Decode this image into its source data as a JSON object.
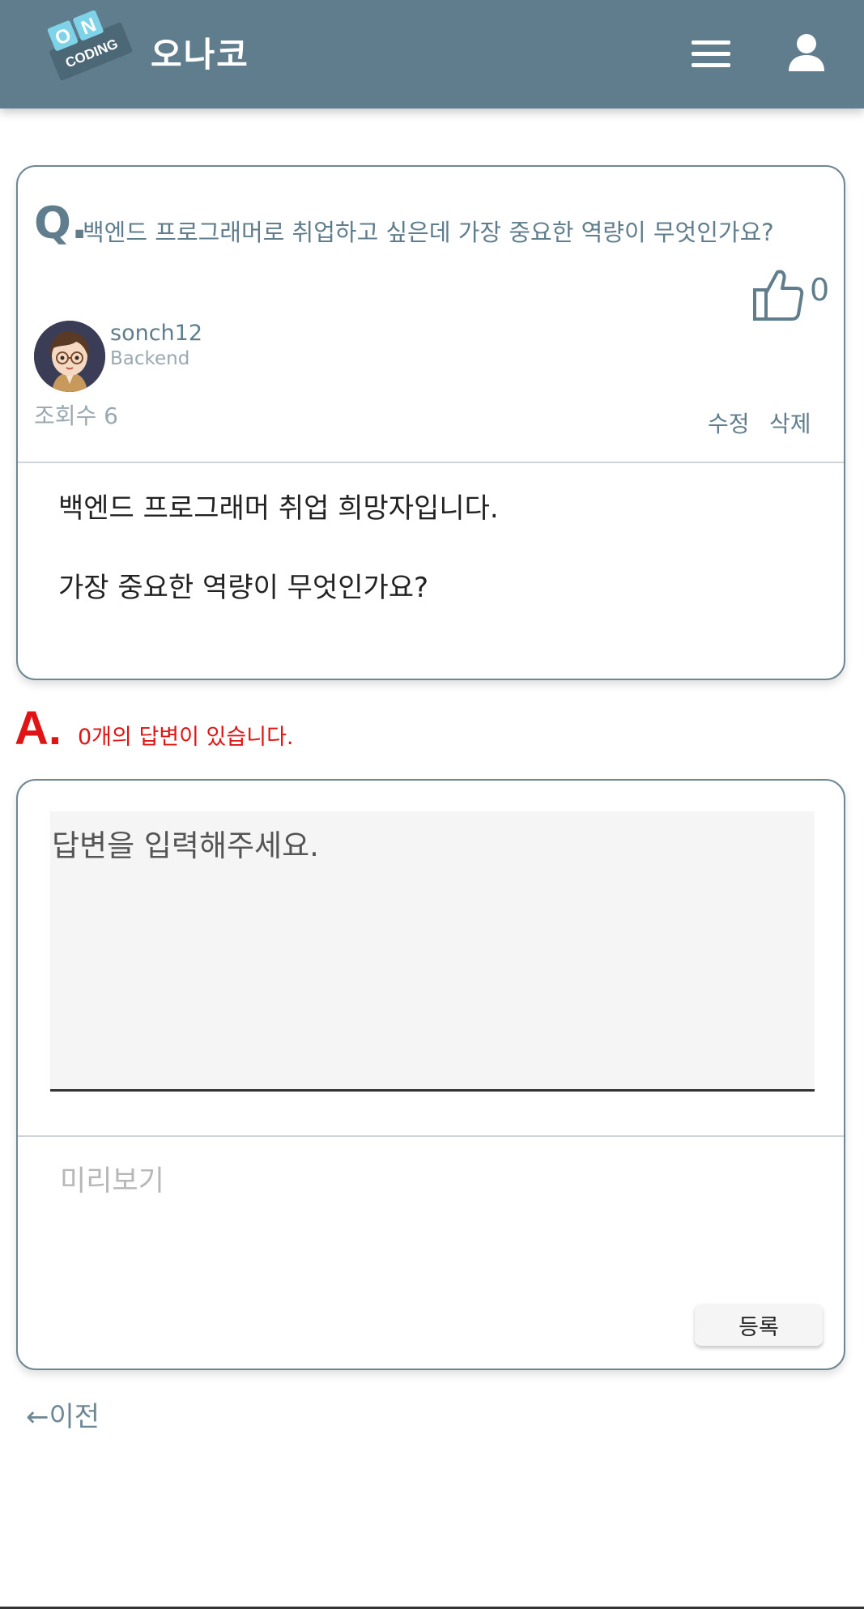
{
  "header": {
    "logo_top": "ON",
    "logo_bottom": "CODING",
    "brand": "오나코",
    "bg_color": "#5f7d8c"
  },
  "question": {
    "q_mark": "Q.",
    "title": "백엔드 프로그래머로 취업하고 싶은데 가장 중요한 역량이 무엇인가요?",
    "like_count": "0",
    "author_name": "sonch12",
    "author_role": "Backend",
    "views": "조회수 6",
    "edit_label": "수정",
    "delete_label": "삭제",
    "body_line1": "백엔드 프로그래머 취업 희망자입니다.",
    "body_line2": "가장 중요한 역량이 무엇인가요?"
  },
  "answers": {
    "a_mark": "A.",
    "count_text": "0개의 답변이 있습니다.",
    "input_placeholder": "답변을 입력해주세요.",
    "preview_label": "미리보기",
    "submit_label": "등록"
  },
  "nav": {
    "back_label": "←이전"
  },
  "colors": {
    "accent": "#5f7d8c",
    "answer_red": "#e01414",
    "logo_tile": "#7fd3e8"
  }
}
